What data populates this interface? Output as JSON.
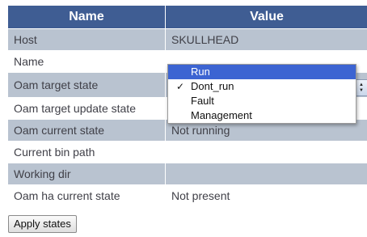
{
  "table": {
    "headers": [
      "Name",
      "Value"
    ],
    "rows": [
      {
        "name": "Host",
        "value": "SKULLHEAD"
      },
      {
        "name": "Name",
        "value": ""
      },
      {
        "name": "Oam target state",
        "value": ""
      },
      {
        "name": "Oam target update state",
        "value": ""
      },
      {
        "name": "Oam current state",
        "value": "Not running"
      },
      {
        "name": "Current bin path",
        "value": ""
      },
      {
        "name": "Working dir",
        "value": ""
      },
      {
        "name": "Oam ha current state",
        "value": "Not present"
      }
    ]
  },
  "target_state_select": {
    "selected": "Dont_run",
    "highlighted": "Run",
    "options": [
      "Run",
      "Dont_run",
      "Fault",
      "Management"
    ],
    "check_glyph": "✓"
  },
  "actions": {
    "apply_label": "Apply states"
  },
  "colors": {
    "header_bg": "#3f5d93",
    "alt_row_bg": "#b9c3d0",
    "highlight_bg": "#3c64d2"
  }
}
